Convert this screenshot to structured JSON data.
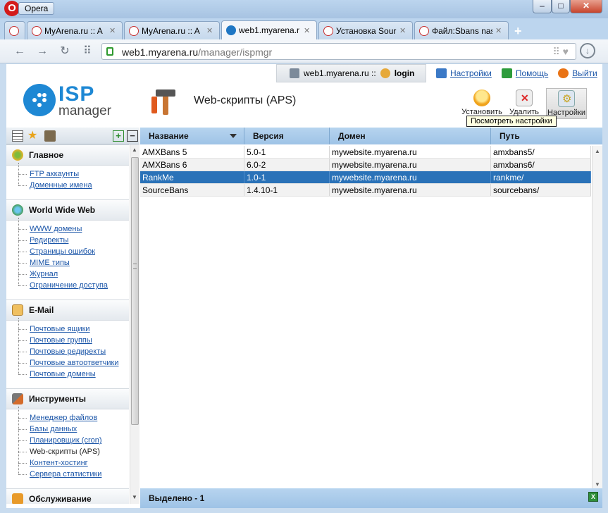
{
  "window": {
    "app_button": "Opera",
    "controls": {
      "minimize": "–",
      "maximize": "□",
      "close": "✕"
    }
  },
  "tabs": [
    {
      "label": "",
      "icon": "myarena-icon",
      "active": false
    },
    {
      "label": "MyArena.ru :: A",
      "icon": "myarena-icon",
      "active": false
    },
    {
      "label": "MyArena.ru :: A",
      "icon": "myarena-icon",
      "active": false
    },
    {
      "label": "web1.myarena.r",
      "icon": "ispmanager-icon",
      "active": true
    },
    {
      "label": "Установка Sour",
      "icon": "myarena-icon",
      "active": false
    },
    {
      "label": "Файл:Sbans nas",
      "icon": "myarena-icon",
      "active": false
    }
  ],
  "address": {
    "host": "web1.myarena.ru",
    "path": "/manager/ispmgr"
  },
  "userbar": {
    "server": "web1.myarena.ru ::",
    "user": "login"
  },
  "top_links": {
    "settings": "Настройки",
    "help": "Помощь",
    "logout": "Выйти"
  },
  "logo": {
    "line1": "ISP",
    "line2": "manager"
  },
  "page_title": "Web-скрипты (APS)",
  "toolbar": {
    "install": "Установить",
    "delete": "Удалить",
    "settings": "Настройки"
  },
  "tooltip": "Посмотреть настройки",
  "sidebar": {
    "groups": [
      {
        "title": "Главное",
        "icon": "home-icon",
        "items": [
          "FTP аккаунты",
          "Доменные имена"
        ]
      },
      {
        "title": "World Wide Web",
        "icon": "globe-icon",
        "items": [
          "WWW домены",
          "Редиректы",
          "Страницы ошибок",
          "MIME типы",
          "Журнал",
          "Ограничение доступа"
        ]
      },
      {
        "title": "E-Mail",
        "icon": "mail-icon",
        "items": [
          "Почтовые ящики",
          "Почтовые группы",
          "Почтовые редиректы",
          "Почтовые автоответчики",
          "Почтовые домены"
        ]
      },
      {
        "title": "Инструменты",
        "icon": "tools-icon",
        "items": [
          "Менеджер файлов",
          "Базы данных",
          "Планировщик (cron)",
          "Web-скрипты (APS)",
          "Контент-хостинг",
          "Сервера статистики"
        ]
      },
      {
        "title": "Обслуживание",
        "icon": "maintenance-icon",
        "items": []
      }
    ],
    "current_item": "Web-скрипты (APS)"
  },
  "table": {
    "columns": [
      "Название",
      "Версия",
      "Домен",
      "Путь"
    ],
    "rows": [
      [
        "AMXBans 5",
        "5.0-1",
        "mywebsite.myarena.ru",
        "amxbans5/"
      ],
      [
        "AMXBans 6",
        "6.0-2",
        "mywebsite.myarena.ru",
        "amxbans6/"
      ],
      [
        "RankMe",
        "1.0-1",
        "mywebsite.myarena.ru",
        "rankme/"
      ],
      [
        "SourceBans",
        "1.4.10-1",
        "mywebsite.myarena.ru",
        "sourcebans/"
      ]
    ],
    "selected_row": 2
  },
  "status": "Выделено - 1"
}
